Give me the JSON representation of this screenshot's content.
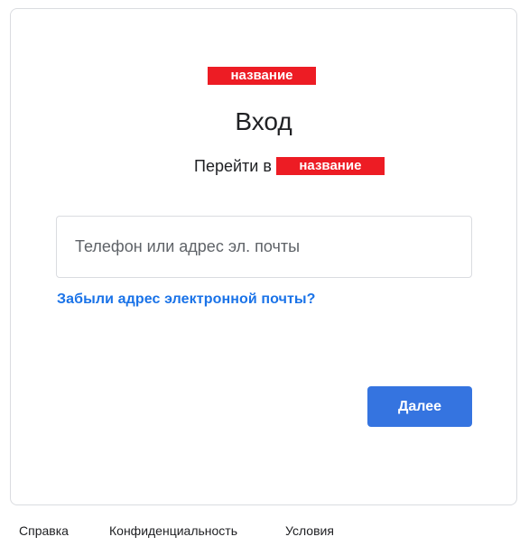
{
  "brand": {
    "logo_text": "название",
    "color": "#ed1c24"
  },
  "header": {
    "title": "Вход",
    "subtitle_prefix": "Перейти в",
    "subtitle_brand": "название"
  },
  "form": {
    "identifier_placeholder": "Телефон или адрес эл. почты",
    "identifier_value": "",
    "forgot_email_link": "Забыли адрес электронной почты?",
    "next_button": "Далее"
  },
  "footer": {
    "help": "Справка",
    "privacy": "Конфиденциальность",
    "terms": "Условия"
  },
  "colors": {
    "accent": "#1a73e8",
    "button": "#3574e0",
    "border": "#dadce0"
  }
}
